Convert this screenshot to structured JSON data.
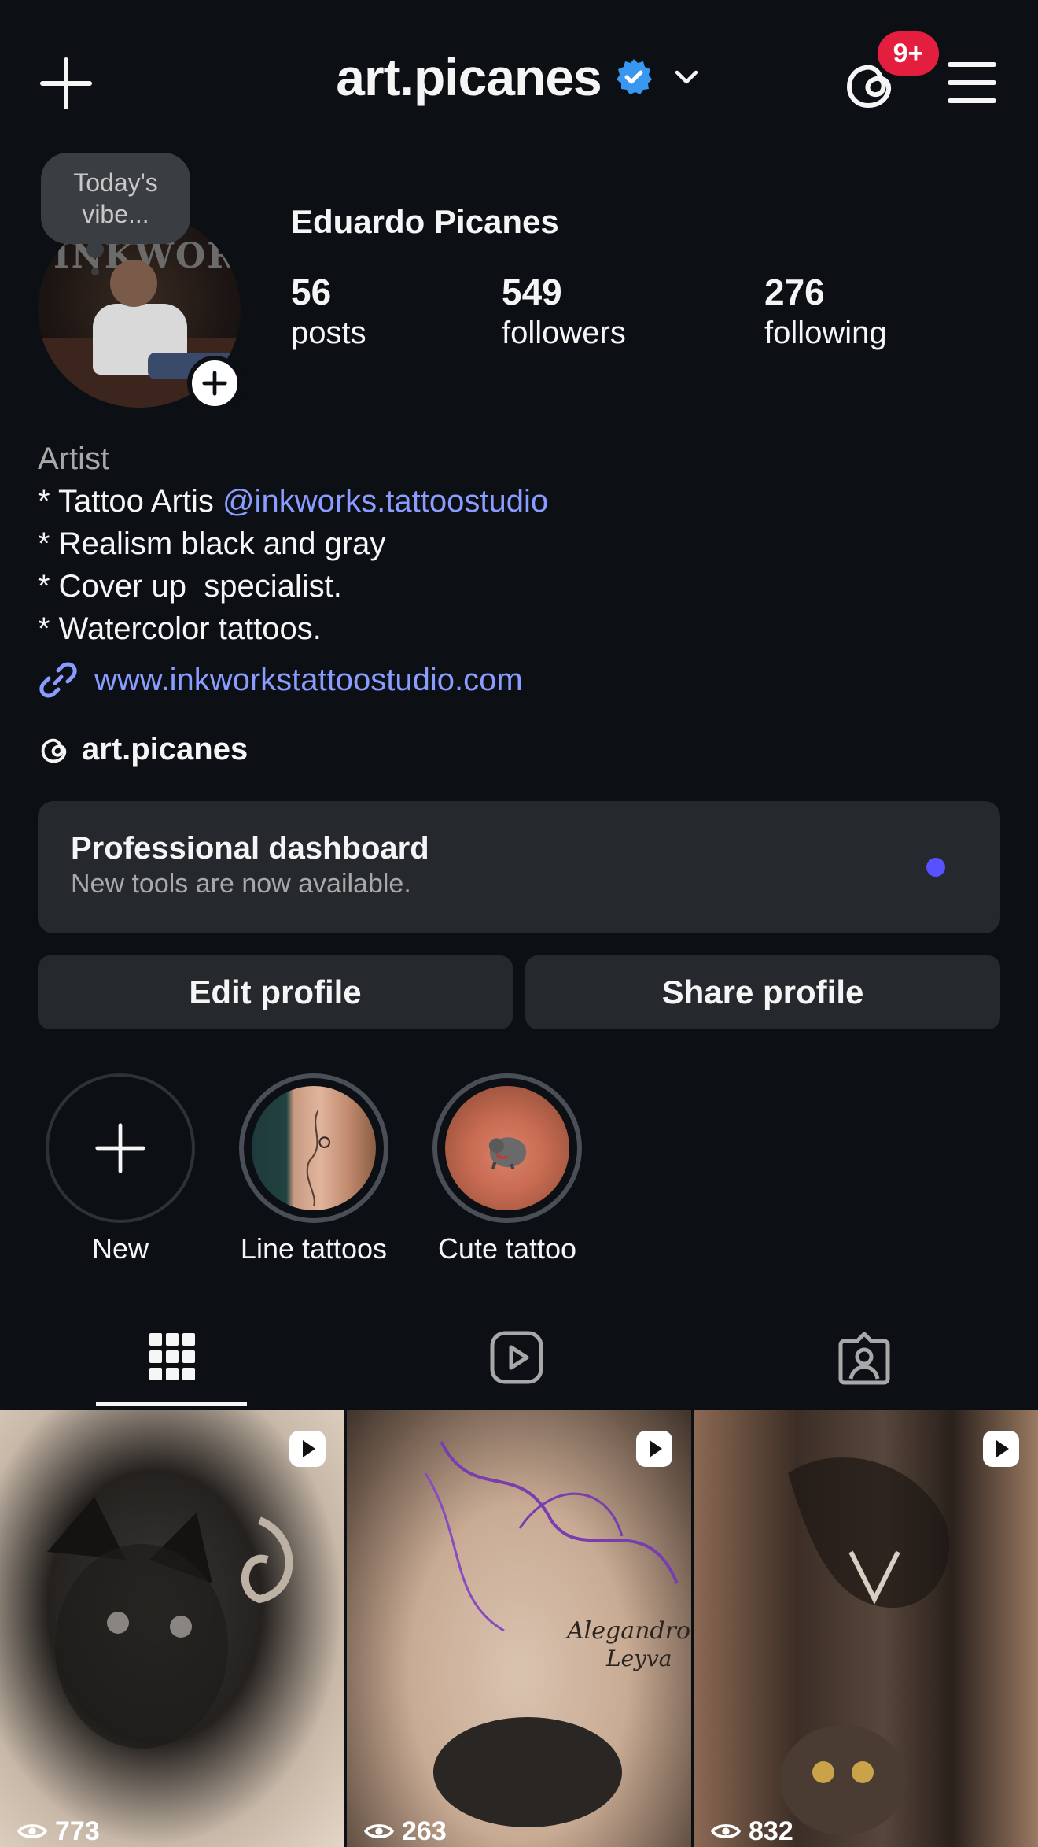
{
  "header": {
    "username": "art.picanes",
    "notification_count": "9+"
  },
  "profile": {
    "note": "Today's vibe...",
    "avatar_text": "INKWORKS",
    "full_name": "Eduardo Picanes",
    "stats": [
      {
        "value": "56",
        "label": "posts"
      },
      {
        "value": "549",
        "label": "followers"
      },
      {
        "value": "276",
        "label": "following"
      }
    ]
  },
  "bio": {
    "category": "Artist",
    "line1_prefix": "* Tattoo Artis ",
    "line1_mention": "@inkworks.tattoostudio",
    "line2": "* Realism black and gray",
    "line3": "* Cover up  specialist.",
    "line4": "* Watercolor tattoos.",
    "link": "www.inkworkstattoostudio.com",
    "threads_handle": "art.picanes"
  },
  "dashboard": {
    "title": "Professional dashboard",
    "subtitle": "New tools are now available."
  },
  "buttons": {
    "edit": "Edit profile",
    "share": "Share profile"
  },
  "highlights": [
    {
      "label": "New"
    },
    {
      "label": "Line tattoos"
    },
    {
      "label": "Cute tattoo"
    }
  ],
  "tabs": [
    "grid-icon",
    "reels-icon",
    "tagged-icon"
  ],
  "posts": [
    {
      "views": "773"
    },
    {
      "views": "263"
    },
    {
      "views": "832"
    }
  ],
  "colors": {
    "background": "#0c1014",
    "card": "#25292e",
    "link": "#8a9cff",
    "badge": "#e41e3f",
    "verified": "#3897f0",
    "dot": "#5851ff"
  }
}
